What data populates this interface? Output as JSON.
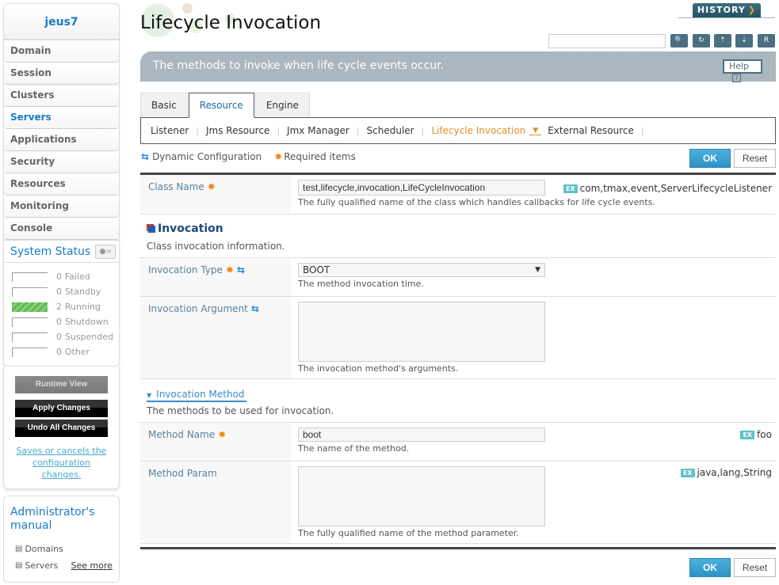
{
  "sidebar": {
    "domain_name": "jeus7",
    "nav": [
      {
        "label": "Domain"
      },
      {
        "label": "Session"
      },
      {
        "label": "Clusters"
      },
      {
        "label": "Servers",
        "active": true
      },
      {
        "label": "Applications"
      },
      {
        "label": "Security"
      },
      {
        "label": "Resources"
      },
      {
        "label": "Monitoring"
      },
      {
        "label": "Console"
      }
    ],
    "system_status": {
      "title": "System Status",
      "rows": [
        {
          "count": "0",
          "label": "Failed",
          "fill": 0
        },
        {
          "count": "0",
          "label": "Standby",
          "fill": 0
        },
        {
          "count": "2",
          "label": "Running",
          "fill": 1
        },
        {
          "count": "0",
          "label": "Shutdown",
          "fill": 0
        },
        {
          "count": "0",
          "label": "Suspended",
          "fill": 0
        },
        {
          "count": "0",
          "label": "Other",
          "fill": 0
        }
      ]
    },
    "runtime_view_label": "Runtime View",
    "apply_changes_label": "Apply Changes",
    "undo_all_label": "Undo All Changes",
    "save_note": "Saves or cancels the configuration changes.",
    "manual": {
      "title": "Administrator's manual",
      "links": [
        "Domains",
        "Servers"
      ],
      "see_more": "See more"
    }
  },
  "header": {
    "title": "Lifecycle Invocation",
    "history_label": "HISTORY",
    "search_placeholder": "",
    "toolbar_icons": [
      "search-icon",
      "refresh-icon",
      "xml-export-icon",
      "xml-import-icon",
      "report-icon"
    ],
    "description": "The methods to invoke when life cycle events occur.",
    "help_label": "Help"
  },
  "tabs": [
    {
      "label": "Basic"
    },
    {
      "label": "Resource",
      "active": true
    },
    {
      "label": "Engine"
    }
  ],
  "subtabs": [
    {
      "label": "Listener"
    },
    {
      "label": "Jms Resource"
    },
    {
      "label": "Jmx Manager"
    },
    {
      "label": "Scheduler"
    },
    {
      "label": "Lifecycle Invocation",
      "active": true
    },
    {
      "label": "External Resource"
    }
  ],
  "legend": {
    "dynamic": "Dynamic Configuration",
    "required": "Required items"
  },
  "buttons": {
    "ok": "OK",
    "reset": "Reset"
  },
  "form": {
    "class_name": {
      "label": "Class Name",
      "value": "test,lifecycle,invocation,LifeCycleInvocation",
      "hint": "The fully qualified name of the class which handles callbacks for life cycle events.",
      "example": "com,tmax,event,ServerLifecycleListener"
    },
    "invocation": {
      "title": "Invocation",
      "description": "Class invocation information.",
      "type": {
        "label": "Invocation Type",
        "value": "BOOT",
        "hint": "The method invocation time."
      },
      "argument": {
        "label": "Invocation Argument",
        "value": "",
        "hint": "The invocation method's arguments."
      }
    },
    "method": {
      "title": "Invocation Method",
      "description": "The methods to be used for invocation.",
      "name": {
        "label": "Method Name",
        "value": "boot",
        "hint": "The name of the method.",
        "example": "foo"
      },
      "param": {
        "label": "Method Param",
        "value": "",
        "hint": "The fully qualified name of the method parameter.",
        "example": "java,lang,String"
      }
    }
  },
  "colors": {
    "accent_blue": "#1a7ac8",
    "active_orange": "#e0902a",
    "ok_button": "#3aa3d2",
    "banner": "#a9b5be"
  }
}
